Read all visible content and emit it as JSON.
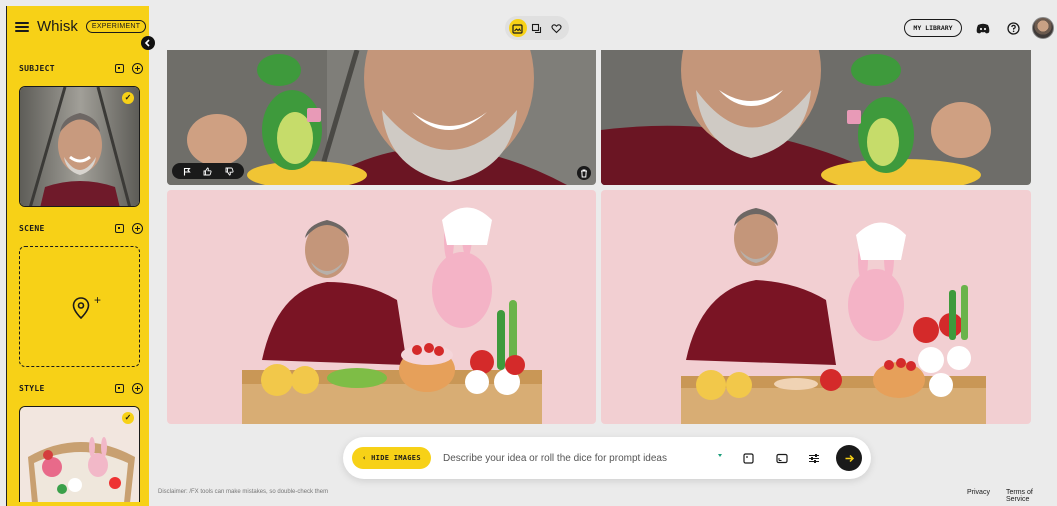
{
  "app": {
    "name": "Whisk",
    "badge": "EXPERIMENT"
  },
  "sidebar": {
    "sections": [
      {
        "title": "SUBJECT"
      },
      {
        "title": "SCENE"
      },
      {
        "title": "STYLE"
      }
    ],
    "collapse_icon": "chevron-left-icon",
    "selected_mark": "✓"
  },
  "topbar": {
    "modes": [
      {
        "icon": "image-add-icon",
        "active": true
      },
      {
        "icon": "remix-icon",
        "active": false
      },
      {
        "icon": "heart-icon",
        "active": false
      }
    ],
    "library_label": "MY LIBRARY",
    "icons": [
      "discord-icon",
      "help-icon",
      "avatar"
    ]
  },
  "images": [
    {
      "name": "generated-image-1"
    },
    {
      "name": "generated-image-2"
    },
    {
      "name": "generated-image-3"
    },
    {
      "name": "generated-image-4"
    }
  ],
  "image_actions": [
    "flag-icon",
    "thumbs-up-icon",
    "thumbs-down-icon",
    "trash-icon"
  ],
  "prompt": {
    "hide_label": "HIDE IMAGES",
    "placeholder": "Describe your idea or roll the dice for prompt ideas",
    "value": ""
  },
  "footer": {
    "disclaimer": "Disclaimer: /FX tools can make mistakes, so double-check them",
    "privacy": "Privacy",
    "terms": "Terms of Service"
  },
  "colors": {
    "accent": "#f7d117",
    "background": "#ebebeb",
    "dark": "#1a1a1a"
  }
}
